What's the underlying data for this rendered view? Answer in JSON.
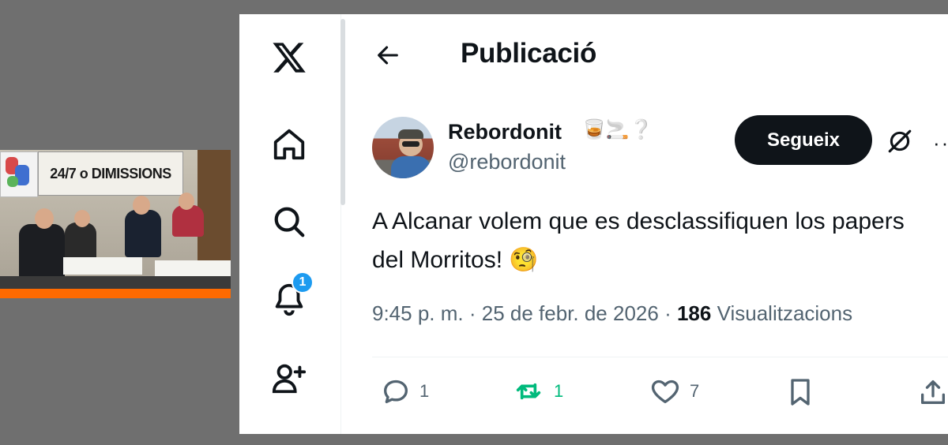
{
  "video": {
    "banner_text": "24/7 o DIMISSIONS"
  },
  "nav": {
    "notifications_badge": "1",
    "icons": [
      "x-logo-icon",
      "home-icon",
      "search-icon",
      "bell-icon",
      "add-user-icon"
    ]
  },
  "header": {
    "title": "Publicació"
  },
  "post": {
    "author_name": "Rebordonit",
    "author_emojis": "🥃🚬❔",
    "author_handle": "@rebordonit",
    "follow_label": "Segueix",
    "text": "A Alcanar volem que es desclassifiquen los papers del Morritos! 🧐",
    "time": "9:45 p. m.",
    "date": "25 de febr. de 2026",
    "views_count": "186",
    "views_label": "Visualitzacions"
  },
  "actions": {
    "replies": "1",
    "retweets": "1",
    "likes": "7"
  },
  "colors": {
    "text": "#0f1419",
    "secondary": "#536471",
    "accent": "#1d9bf0",
    "retweet_green": "#00ba7c"
  }
}
